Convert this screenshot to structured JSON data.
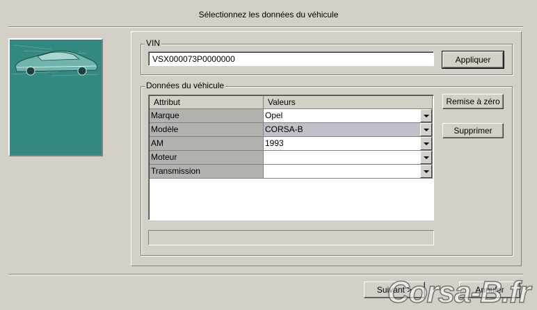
{
  "dialog": {
    "title": "Sélectionnez les données du véhicule"
  },
  "vin": {
    "label": "VIN",
    "value": "VSX000073P0000000",
    "apply_label": "Appliquer"
  },
  "vehicle": {
    "label": "Données du véhicule",
    "columns": [
      "Attribut",
      "Valeurs"
    ],
    "rows": [
      {
        "attribute": "Marque",
        "value": "Opel"
      },
      {
        "attribute": "Modèle",
        "value": "CORSA-B"
      },
      {
        "attribute": "AM",
        "value": "1993"
      },
      {
        "attribute": "Moteur",
        "value": ""
      },
      {
        "attribute": "Transmission",
        "value": ""
      }
    ],
    "selected_row": 1,
    "reset_label": "Remise à zéro",
    "delete_label": "Supprimer"
  },
  "footer": {
    "next_label": "Suivant >",
    "cancel_label": "Annuler"
  },
  "watermark": "Corsa-B.fr",
  "colors": {
    "panel_bg": "#d4d0c8",
    "side_image_bg": "#33897f",
    "attribute_cell_bg": "#b4b2ae",
    "selected_row_bg": "#c0c0c8"
  }
}
